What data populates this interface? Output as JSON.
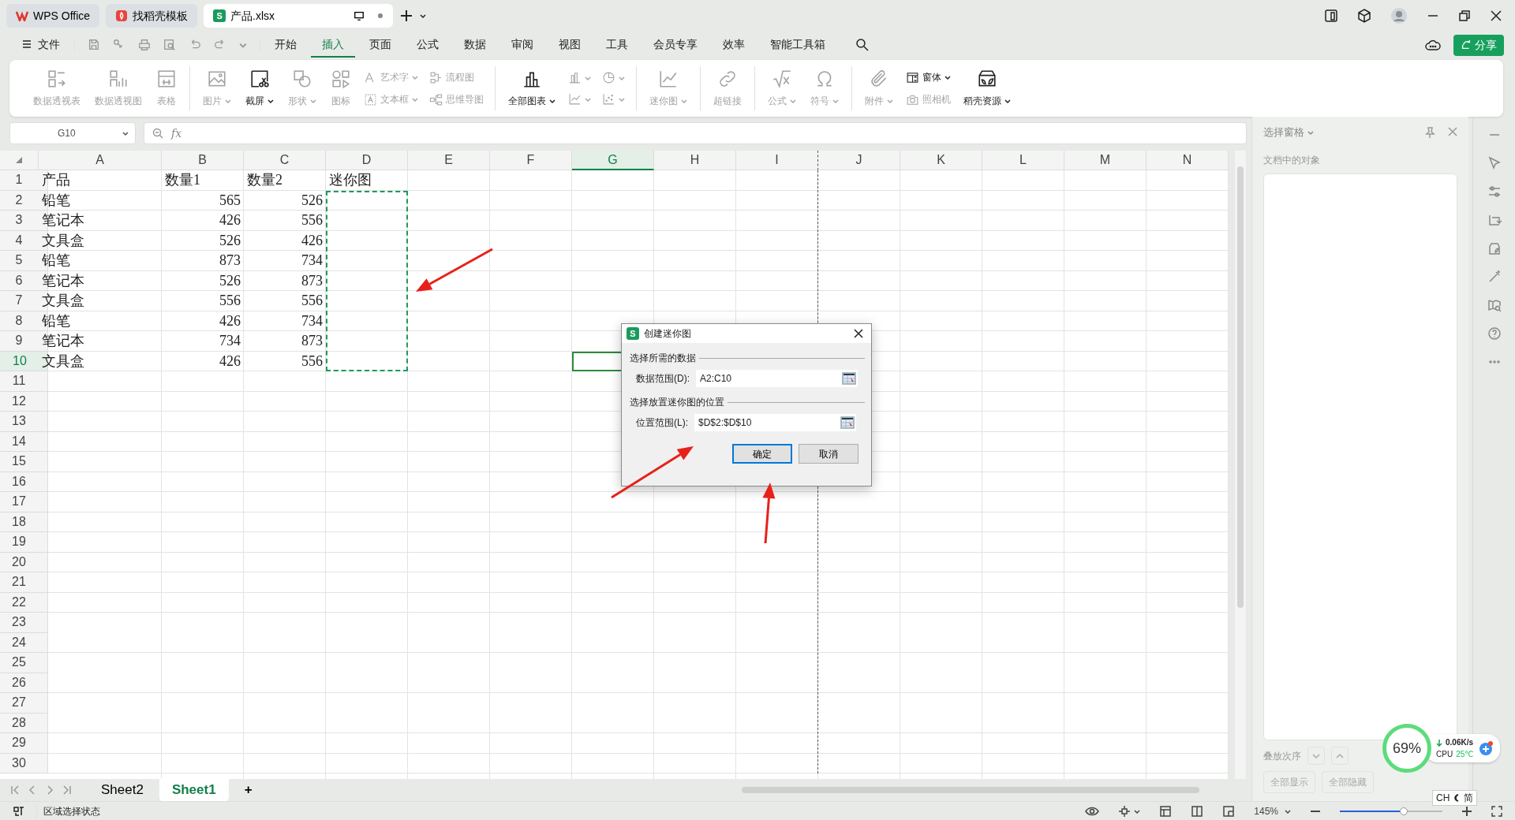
{
  "title_bar": {
    "tabs": [
      {
        "label": "WPS Office",
        "kind": "home",
        "selected": false
      },
      {
        "label": "找稻壳模板",
        "kind": "docer",
        "selected": false
      },
      {
        "label": "产品.xlsx",
        "kind": "sheet",
        "icon_letter": "S",
        "selected": true
      }
    ]
  },
  "menu": {
    "file_label": "文件",
    "tabs": [
      {
        "label": "开始",
        "selected": false
      },
      {
        "label": "插入",
        "selected": true
      },
      {
        "label": "页面",
        "selected": false
      },
      {
        "label": "公式",
        "selected": false
      },
      {
        "label": "数据",
        "selected": false
      },
      {
        "label": "审阅",
        "selected": false
      },
      {
        "label": "视图",
        "selected": false
      },
      {
        "label": "工具",
        "selected": false
      },
      {
        "label": "会员专享",
        "selected": false
      },
      {
        "label": "效率",
        "selected": false
      },
      {
        "label": "智能工具箱",
        "selected": false
      }
    ],
    "share_label": "分享"
  },
  "ribbon": {
    "groups": [
      {
        "items": [
          {
            "label": "数据透视表",
            "kind": "big",
            "disabled": true,
            "dropdown": false
          },
          {
            "label": "数据透视图",
            "kind": "big",
            "disabled": true,
            "dropdown": false
          },
          {
            "label": "表格",
            "kind": "big",
            "disabled": true,
            "dropdown": false
          }
        ]
      },
      {
        "items": [
          {
            "label": "图片",
            "kind": "big",
            "disabled": true,
            "dropdown": true
          },
          {
            "label": "截屏",
            "kind": "big",
            "disabled": false,
            "dropdown": true
          },
          {
            "label": "形状",
            "kind": "big",
            "disabled": true,
            "dropdown": true
          },
          {
            "label": "图标",
            "kind": "big",
            "disabled": true,
            "dropdown": false
          },
          {
            "label": "艺术字",
            "kind": "small",
            "disabled": true,
            "dropdown": true
          },
          {
            "label": "文本框",
            "kind": "small",
            "disabled": true,
            "dropdown": true
          },
          {
            "label": "流程图",
            "kind": "small",
            "disabled": true,
            "dropdown": false
          },
          {
            "label": "思维导图",
            "kind": "small",
            "disabled": true,
            "dropdown": false
          }
        ]
      },
      {
        "items": [
          {
            "label": "全部图表",
            "kind": "big",
            "disabled": false,
            "dropdown": true
          },
          {
            "kind": "small",
            "disabled": true,
            "dropdown": true
          },
          {
            "kind": "small",
            "disabled": true,
            "dropdown": true
          },
          {
            "kind": "small",
            "disabled": true,
            "dropdown": true
          },
          {
            "kind": "small",
            "disabled": true,
            "dropdown": true
          }
        ]
      },
      {
        "items": [
          {
            "label": "迷你图",
            "kind": "big",
            "disabled": true,
            "dropdown": true
          }
        ]
      },
      {
        "items": [
          {
            "label": "超链接",
            "kind": "big",
            "disabled": true,
            "dropdown": false
          }
        ]
      },
      {
        "items": [
          {
            "label": "公式",
            "kind": "big",
            "disabled": true,
            "dropdown": true
          },
          {
            "label": "符号",
            "kind": "big",
            "disabled": true,
            "dropdown": true
          }
        ]
      },
      {
        "items": [
          {
            "label": "附件",
            "kind": "big",
            "disabled": true,
            "dropdown": true
          },
          {
            "label": "窗体",
            "kind": "small",
            "disabled": false,
            "dropdown": true
          },
          {
            "label": "照相机",
            "kind": "small",
            "disabled": true,
            "dropdown": false
          },
          {
            "label": "稻壳资源",
            "kind": "big",
            "disabled": false,
            "dropdown": true
          }
        ]
      }
    ]
  },
  "formula_bar": {
    "name_box": "G10",
    "fx": "fx"
  },
  "sheet": {
    "columns": [
      {
        "label": "A",
        "selected": false,
        "marquee": false,
        "page_break_after": false
      },
      {
        "label": "B",
        "selected": false,
        "marquee": false,
        "page_break_after": false
      },
      {
        "label": "C",
        "selected": false,
        "marquee": false,
        "page_break_after": false
      },
      {
        "label": "D",
        "selected": false,
        "marquee": true,
        "page_break_after": false
      },
      {
        "label": "E",
        "selected": false,
        "marquee": false,
        "page_break_after": false
      },
      {
        "label": "F",
        "selected": false,
        "marquee": false,
        "page_break_after": false
      },
      {
        "label": "G",
        "selected": true,
        "marquee": false,
        "page_break_after": false
      },
      {
        "label": "H",
        "selected": false,
        "marquee": false,
        "page_break_after": false
      },
      {
        "label": "I",
        "selected": false,
        "marquee": false,
        "page_break_after": true
      },
      {
        "label": "J",
        "selected": false,
        "marquee": false,
        "page_break_after": false
      },
      {
        "label": "K",
        "selected": false,
        "marquee": false,
        "page_break_after": false
      },
      {
        "label": "L",
        "selected": false,
        "marquee": false,
        "page_break_after": false
      },
      {
        "label": "M",
        "selected": false,
        "marquee": false,
        "page_break_after": false
      },
      {
        "label": "N",
        "selected": false,
        "marquee": false,
        "page_break_after": false
      }
    ],
    "rows": [
      {
        "label": "1",
        "selected": false,
        "marquee": false,
        "cells": [
          "产品",
          "数量1",
          "数量2",
          "迷你图"
        ]
      },
      {
        "label": "2",
        "selected": false,
        "marquee": true,
        "cells": [
          "铅笔",
          "565",
          "526"
        ]
      },
      {
        "label": "3",
        "selected": false,
        "marquee": true,
        "cells": [
          "笔记本",
          "426",
          "556"
        ]
      },
      {
        "label": "4",
        "selected": false,
        "marquee": true,
        "cells": [
          "文具盒",
          "526",
          "426"
        ]
      },
      {
        "label": "5",
        "selected": false,
        "marquee": true,
        "cells": [
          "铅笔",
          "873",
          "734"
        ]
      },
      {
        "label": "6",
        "selected": false,
        "marquee": true,
        "cells": [
          "笔记本",
          "526",
          "873"
        ]
      },
      {
        "label": "7",
        "selected": false,
        "marquee": true,
        "cells": [
          "文具盒",
          "556",
          "556"
        ]
      },
      {
        "label": "8",
        "selected": false,
        "marquee": true,
        "cells": [
          "铅笔",
          "426",
          "734"
        ]
      },
      {
        "label": "9",
        "selected": false,
        "marquee": true,
        "cells": [
          "笔记本",
          "734",
          "873"
        ]
      },
      {
        "label": "10",
        "selected": true,
        "marquee": true,
        "cells": [
          "文具盒",
          "426",
          "556"
        ]
      },
      {
        "label": "11",
        "selected": false,
        "marquee": false,
        "cells": []
      },
      {
        "label": "12",
        "selected": false,
        "marquee": false,
        "cells": []
      },
      {
        "label": "13",
        "selected": false,
        "marquee": false,
        "cells": []
      },
      {
        "label": "14",
        "selected": false,
        "marquee": false,
        "cells": []
      },
      {
        "label": "15",
        "selected": false,
        "marquee": false,
        "cells": []
      },
      {
        "label": "16",
        "selected": false,
        "marquee": false,
        "cells": []
      },
      {
        "label": "17",
        "selected": false,
        "marquee": false,
        "cells": []
      },
      {
        "label": "18",
        "selected": false,
        "marquee": false,
        "cells": []
      },
      {
        "label": "19",
        "selected": false,
        "marquee": false,
        "cells": []
      },
      {
        "label": "20",
        "selected": false,
        "marquee": false,
        "cells": []
      },
      {
        "label": "21",
        "selected": false,
        "marquee": false,
        "cells": []
      },
      {
        "label": "22",
        "selected": false,
        "marquee": false,
        "cells": []
      },
      {
        "label": "23",
        "selected": false,
        "marquee": false,
        "cells": []
      },
      {
        "label": "24",
        "selected": false,
        "marquee": false,
        "cells": []
      },
      {
        "label": "25",
        "selected": false,
        "marquee": false,
        "cells": []
      },
      {
        "label": "26",
        "selected": false,
        "marquee": false,
        "cells": []
      },
      {
        "label": "27",
        "selected": false,
        "marquee": false,
        "cells": []
      },
      {
        "label": "28",
        "selected": false,
        "marquee": false,
        "cells": []
      },
      {
        "label": "29",
        "selected": false,
        "marquee": false,
        "cells": []
      },
      {
        "label": "30",
        "selected": false,
        "marquee": false,
        "cells": []
      }
    ]
  },
  "sheet_tabs": [
    {
      "label": "Sheet2",
      "selected": false
    },
    {
      "label": "Sheet1",
      "selected": true
    }
  ],
  "sheet_tabs_add": "+",
  "selection_pane": {
    "title": "选择窗格",
    "subtitle": "文档中的对象",
    "order_label": "叠放次序",
    "buttons": [
      {
        "label": "全部显示",
        "disabled": true
      },
      {
        "label": "全部隐藏",
        "disabled": true
      }
    ]
  },
  "dialog": {
    "title": "创建迷你图",
    "icon_letter": "S",
    "sections": [
      {
        "heading": "选择所需的数据",
        "label": "数据范围(D):",
        "value": "A2:C10"
      },
      {
        "heading": "选择放置迷你图的位置",
        "label": "位置范围(L):",
        "value": "$D$2:$D$10"
      }
    ],
    "buttons": [
      {
        "label": "确定",
        "default": true
      },
      {
        "label": "取消",
        "default": false
      }
    ]
  },
  "status_bar": {
    "mode": "区域选择状态",
    "zoom": "145%",
    "zoom_slider": {
      "level": 0.62
    }
  },
  "ime": {
    "language": "CH",
    "mode": "简"
  },
  "monitor_widget": {
    "percent": "69%",
    "speed": "0.06K/s",
    "cpu_label": "CPU",
    "temperature": "25℃"
  }
}
